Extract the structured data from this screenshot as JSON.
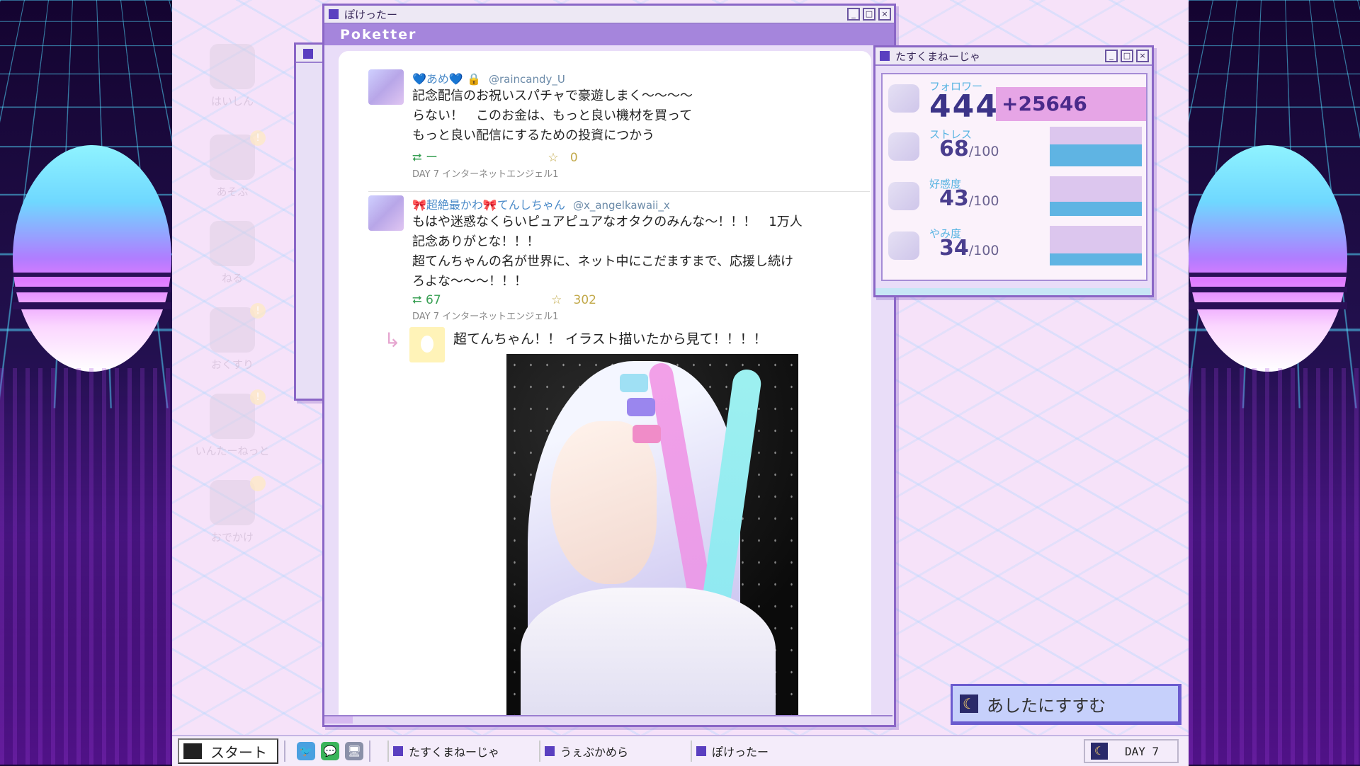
{
  "desktop": {
    "icons": [
      {
        "label": "はいしん",
        "badge": ""
      },
      {
        "label": "あそぶ",
        "badge": "!"
      },
      {
        "label": "ねる",
        "badge": ""
      },
      {
        "label": "おくすり",
        "badge": "!"
      },
      {
        "label": "いんたーねっと",
        "badge": "!"
      },
      {
        "label": "おでかけ",
        "badge": ""
      }
    ]
  },
  "poketter": {
    "window_title": "ぽけったー",
    "app_name": "Poketter",
    "tweets": [
      {
        "name": "💙あめ💙",
        "lock": "🔒",
        "handle": "@raincandy_U",
        "text": "記念配信のお祝いスパチャで豪遊しまく～～～～\nらない！　このお金は、もっと良い機材を買って\nもっと良い配信にするための投資につかう",
        "retweets": "ー",
        "favorites": "0",
        "date": "DAY 7 インターネットエンジェル1"
      },
      {
        "name": "🎀超絶最かわ🎀てんしちゃん",
        "handle": "@x_angelkawaii_x",
        "text": "もはや迷惑なくらいピュアピュアなオタクのみんな～！！！　1万人\n記念ありがとな！！！\n超てんちゃんの名が世界に、ネット中にこだますまで、応援し続け\nろよな～～～！！！",
        "retweets": "67",
        "favorites": "302",
        "date": "DAY 7 インターネットエンジェル1"
      }
    ],
    "quote": {
      "arrow": "↳",
      "text": "超てんちゃん！！ イラスト描いたから見て！！！！"
    },
    "stat_glyphs": {
      "rt": "⮂",
      "fav": "☆"
    }
  },
  "taskmanager": {
    "window_title": "たすくまねーじゃ",
    "followers": {
      "label": "フォロワー",
      "value": "444",
      "delta": "+25646"
    },
    "stats": [
      {
        "label": "ストレス",
        "value": "68",
        "max": "100",
        "level": 0.55
      },
      {
        "label": "好感度",
        "value": "43",
        "max": "100",
        "level": 0.35
      },
      {
        "label": "やみ度",
        "value": "34",
        "max": "100",
        "level": 0.3
      }
    ],
    "bar_color": "#5fb4e3"
  },
  "next_day": {
    "label": "あしたにすすむ",
    "icon": "☾"
  },
  "taskbar": {
    "start_label": "スタート",
    "icons": [
      "🐦",
      "💬",
      "🖥"
    ],
    "tasks": [
      "たすくまねーじゃ",
      "うぇぶかめら",
      "ぽけったー"
    ],
    "day": "DAY 7",
    "day_icon": "☾"
  },
  "window_buttons": {
    "min": "_",
    "max": "□",
    "close": "×"
  }
}
